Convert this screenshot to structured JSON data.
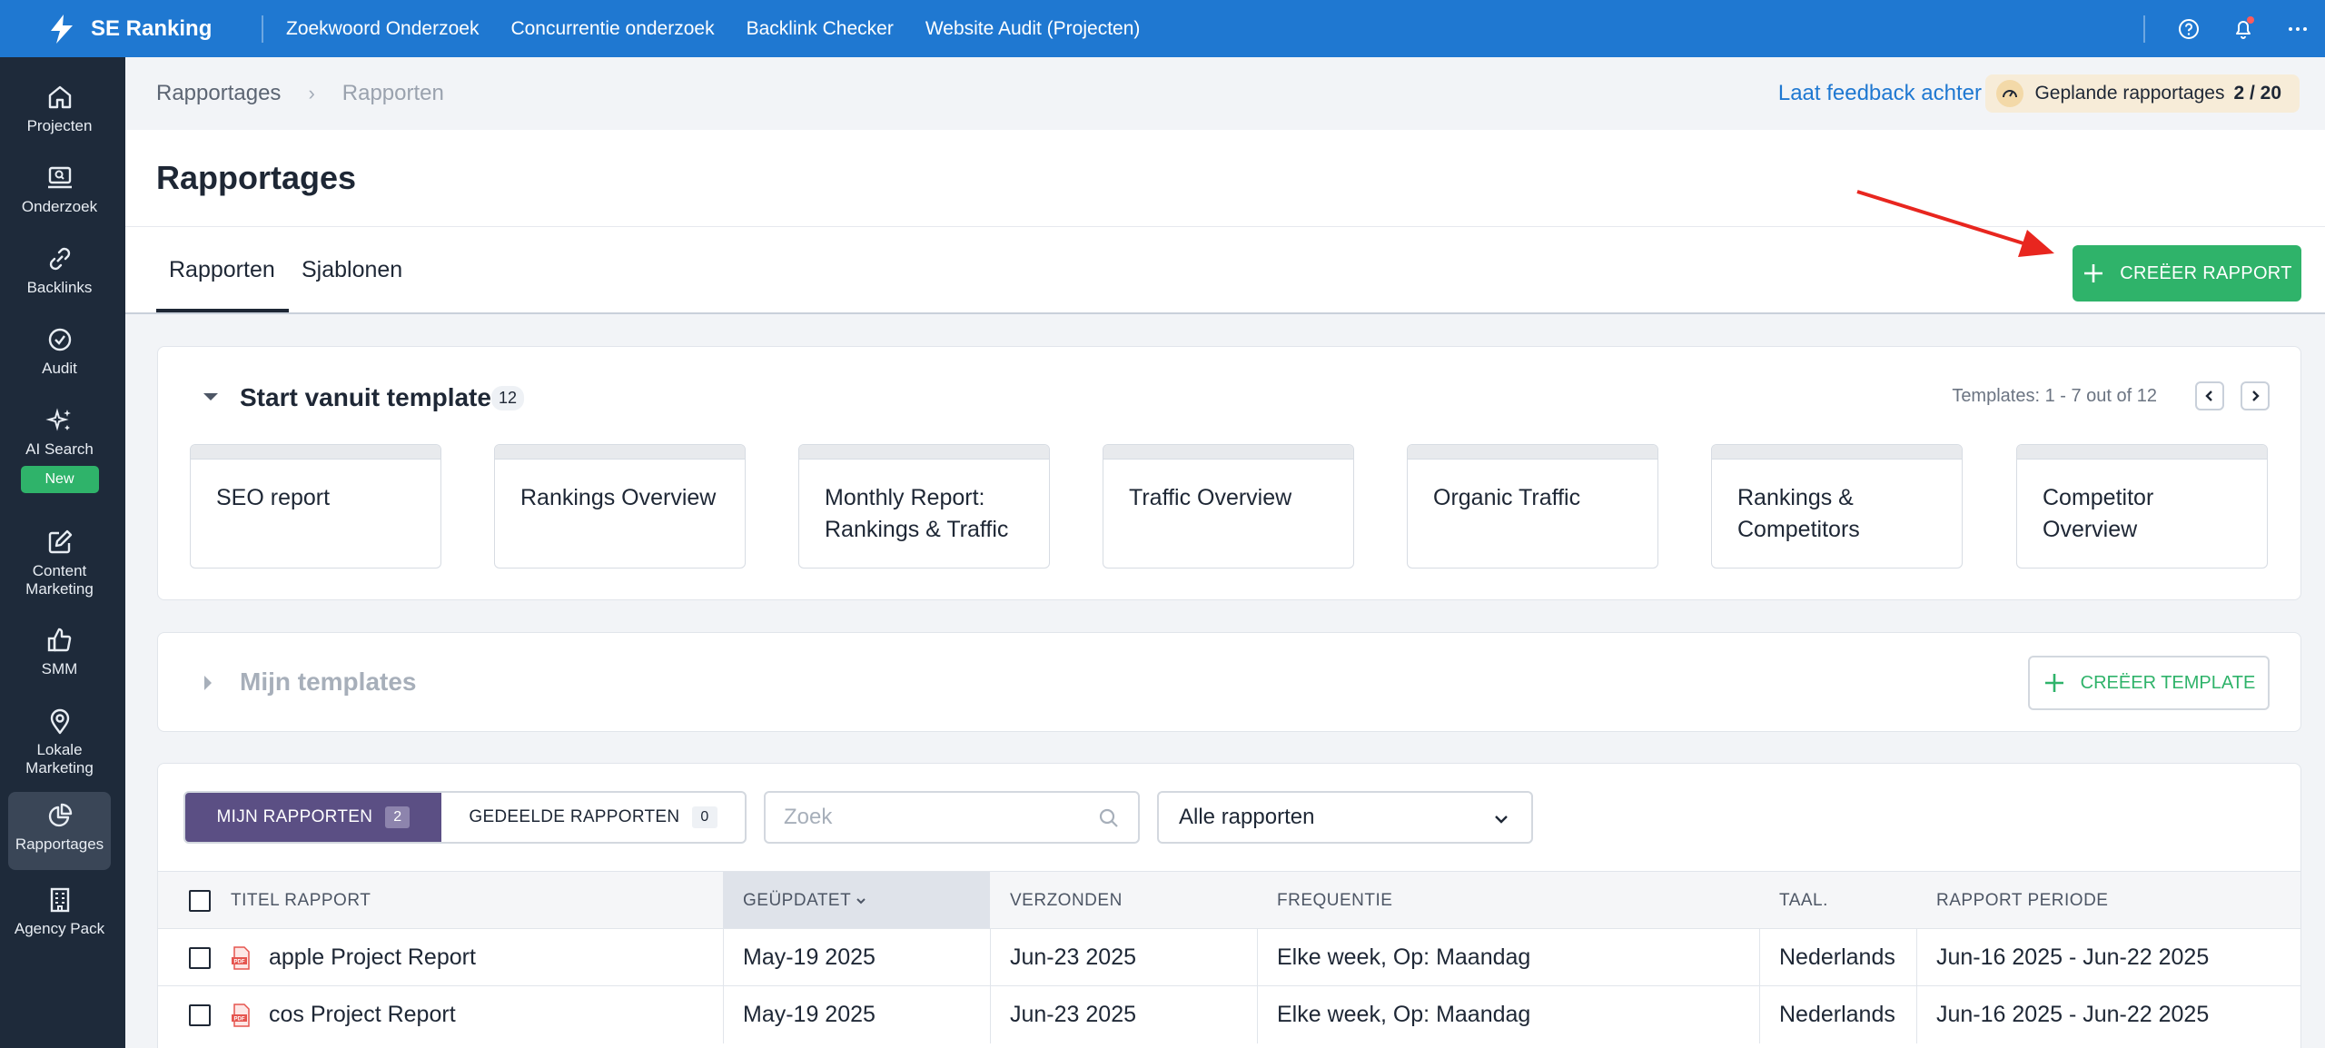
{
  "app": {
    "name": "SE Ranking"
  },
  "topnav": [
    "Zoekwoord Onderzoek",
    "Concurrentie onderzoek",
    "Backlink Checker",
    "Website Audit (Projecten)"
  ],
  "sidebar": [
    {
      "label": "Projecten",
      "icon": "home-icon"
    },
    {
      "label": "Onderzoek",
      "icon": "monitor-search-icon"
    },
    {
      "label": "Backlinks",
      "icon": "link-icon"
    },
    {
      "label": "Audit",
      "icon": "check-circle-icon"
    },
    {
      "label": "AI Search",
      "icon": "sparkles-icon",
      "badge": "New"
    },
    {
      "label": "Content Marketing",
      "icon": "edit-icon"
    },
    {
      "label": "SMM",
      "icon": "thumbs-up-icon"
    },
    {
      "label": "Lokale Marketing",
      "icon": "map-pin-icon"
    },
    {
      "label": "Rapportages",
      "icon": "pie-chart-icon",
      "active": true
    },
    {
      "label": "Agency Pack",
      "icon": "building-icon"
    }
  ],
  "breadcrumb": {
    "root": "Rapportages",
    "current": "Rapporten"
  },
  "feedback_link": "Laat feedback achter",
  "scheduled": {
    "label": "Geplande rapportages",
    "count": "2 / 20"
  },
  "page_title": "Rapportages",
  "tabs": [
    {
      "label": "Rapporten",
      "active": true
    },
    {
      "label": "Sjablonen",
      "active": false
    }
  ],
  "create_report_label": "CREËER RAPPORT",
  "templates_section": {
    "title": "Start vanuit template",
    "count": "12",
    "pager": "Templates: 1 - 7 out of 12",
    "items": [
      "SEO report",
      "Rankings Overview",
      "Monthly Report: Rankings & Traffic",
      "Traffic Overview",
      "Organic Traffic",
      "Rankings & Competitors",
      "Competitor Overview"
    ]
  },
  "my_templates": {
    "title": "Mijn templates",
    "create_label": "CREËER TEMPLATE"
  },
  "reports": {
    "segments": [
      {
        "label": "MIJN RAPPORTEN",
        "count": "2",
        "active": true
      },
      {
        "label": "GEDEELDE RAPPORTEN",
        "count": "0",
        "active": false
      }
    ],
    "search_placeholder": "Zoek",
    "filter_value": "Alle rapporten",
    "columns": [
      "TITEL RAPPORT",
      "GEÜPDATET",
      "VERZONDEN",
      "FREQUENTIE",
      "TAAL.",
      "RAPPORT PERIODE"
    ],
    "rows": [
      {
        "title": "apple Project Report",
        "updated": "May-19 2025",
        "sent": "Jun-23 2025",
        "frequency": "Elke week, Op: Maandag",
        "language": "Nederlands",
        "period": "Jun-16 2025 - Jun-22 2025"
      },
      {
        "title": "cos Project Report",
        "updated": "May-19 2025",
        "sent": "Jun-23 2025",
        "frequency": "Elke week, Op: Maandag",
        "language": "Nederlands",
        "period": "Jun-16 2025 - Jun-22 2025"
      }
    ]
  },
  "colors": {
    "topbar": "#1f78d1",
    "sidebar": "#1e2a3a",
    "accent_green": "#2fb36a",
    "segment_active": "#5b4f84",
    "annotation_arrow": "#e8261f"
  }
}
